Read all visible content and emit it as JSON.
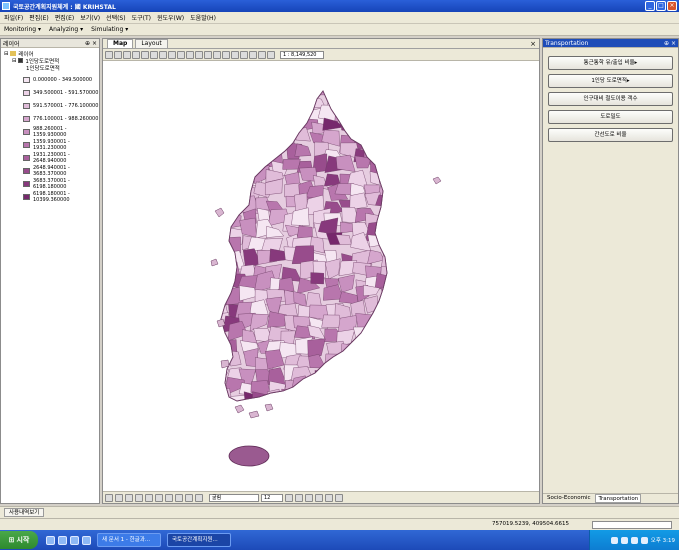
{
  "window": {
    "title": "국토공간계획지원체계 : 國 KRIHSTAL"
  },
  "menu": [
    "파일(F)",
    "편집(E)",
    "편집(E)",
    "보기(V)",
    "선택(S)",
    "도구(T)",
    "윈도우(W)",
    "도움말(H)"
  ],
  "toolbar": {
    "items": [
      "Monitoring",
      "Analyzing",
      "Simulating"
    ]
  },
  "layers_panel": {
    "title": "레이어",
    "root_label": "레이어",
    "layer_name": "1인당도로면적",
    "field_name": "1인당도로면적",
    "legend": [
      {
        "label": "0.000000 - 349.500000",
        "color": "#f5e6f2"
      },
      {
        "label": "349.500001 - 591.570000",
        "color": "#ecd2e7"
      },
      {
        "label": "591.570001 - 776.100000",
        "color": "#e0bcd9"
      },
      {
        "label": "776.100001 - 988.260000",
        "color": "#d5a6cd"
      },
      {
        "label": "988.260001 - 1359.930000",
        "color": "#c890bf"
      },
      {
        "label": "1359.930001 - 1931.230000",
        "color": "#b876ad"
      },
      {
        "label": "1931.230001 - 2648.940000",
        "color": "#a8609c"
      },
      {
        "label": "2648.940001 - 3683.370000",
        "color": "#984c8c"
      },
      {
        "label": "3683.370001 - 6198.180000",
        "color": "#87397c"
      },
      {
        "label": "6198.180001 - 10399.360000",
        "color": "#76286c"
      }
    ]
  },
  "map": {
    "tabs": [
      "Map",
      "Layout"
    ],
    "scale": "1 : 8,149,520",
    "font_name": "굴림",
    "font_size": "12"
  },
  "transportation_panel": {
    "title": "Transportation",
    "buttons": [
      "통근통학 유/출입 비율▸",
      "1인당 도로면적▸",
      "인구대비 철도이용 객수",
      "도로밀도",
      "간선도로 비율"
    ],
    "tabs": [
      "Socio-Economic",
      "Transportation"
    ]
  },
  "bottom_tab": "사용내역보기",
  "status": {
    "coords": "757019.5239, 409504.6615"
  },
  "taskbar": {
    "start": "시작",
    "tasks": [
      "새 문서 1 - 한글과...",
      "국토공간계획지원..."
    ],
    "clock": "오후 3:19"
  }
}
